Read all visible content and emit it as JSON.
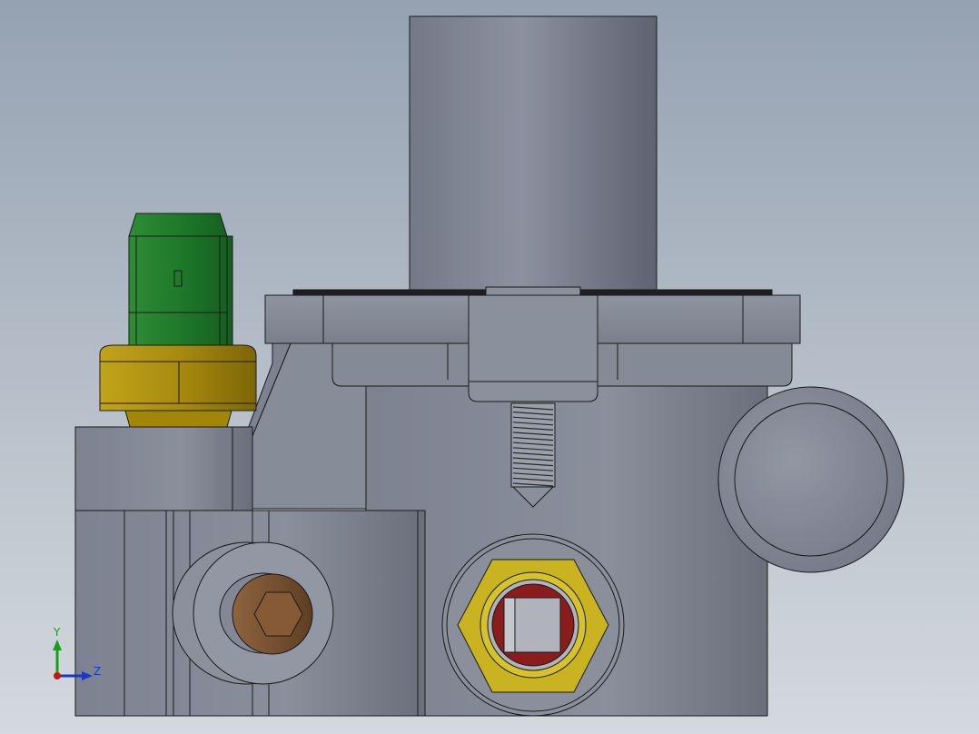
{
  "viewport": {
    "background_top": "#95a2b2",
    "background_bottom": "#d4d9de",
    "body_color": "#8a8f9b",
    "body_dark": "#6b707c",
    "body_light": "#9ea3ae",
    "edge_color": "#1a1a1a"
  },
  "parts": {
    "connector_color": "#1f7a2a",
    "connector_light": "#2e9a3a",
    "nut_color": "#b5960f",
    "nut_dark": "#8a7108",
    "plug_color": "#7a5230",
    "gland_color": "#c9b320",
    "seal_color": "#8a1c1c",
    "pin_color": "#b0b3bb"
  },
  "triad": {
    "y_label": "Y",
    "z_label": "Z",
    "y_color": "#18a018",
    "z_color": "#1838c8",
    "origin_color": "#c01818"
  }
}
